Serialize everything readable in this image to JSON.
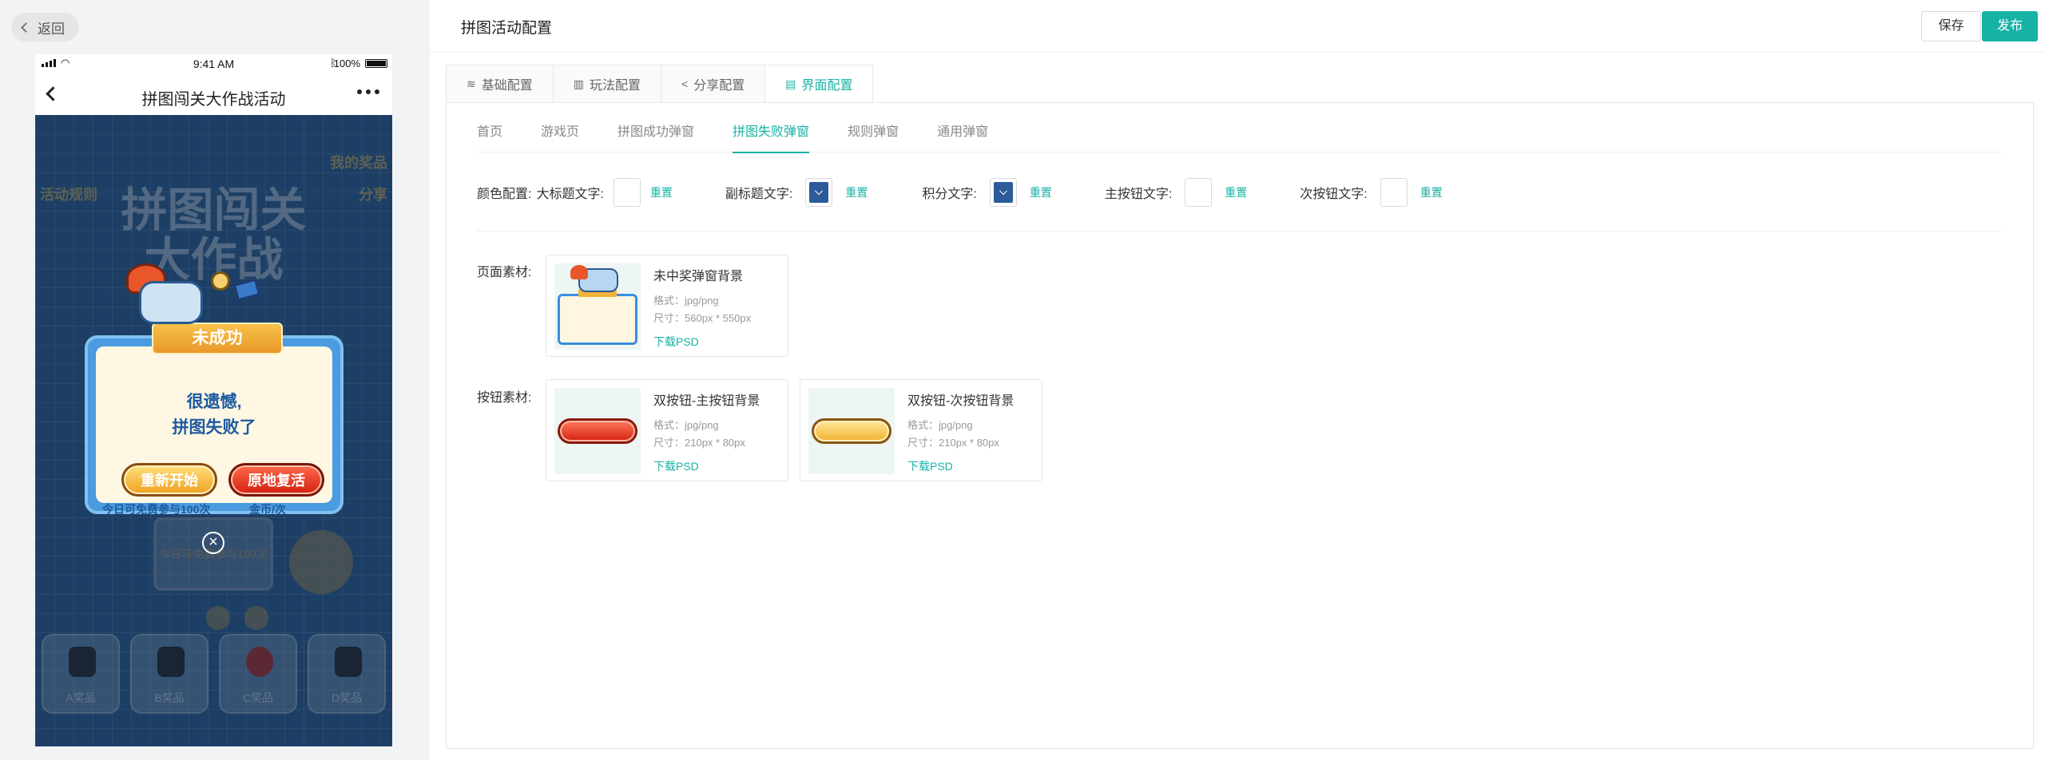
{
  "left": {
    "back_label": "返回",
    "phone": {
      "time": "9:41 AM",
      "battery": "100%",
      "nav_title": "拼图闯关大作战活动"
    },
    "game": {
      "title_line1": "拼图闯关",
      "title_line2": "大作战",
      "corner_left": "活动规则",
      "corner_right1": "我的奖品",
      "corner_right2": "分享",
      "board_text": "今日可免费参与100次",
      "popup": {
        "ribbon": "未成功",
        "message_line1": "很遗憾,",
        "message_line2": "拼图失败了",
        "btn_restart": "重新开始",
        "btn_revive": "原地复活",
        "note_left": "今日可免费参与100次",
        "note_right": "金币/次",
        "close_symbol": "×"
      },
      "prizes": [
        {
          "label": "A奖品"
        },
        {
          "label": "B奖品"
        },
        {
          "label": "C奖品"
        },
        {
          "label": "D奖品"
        }
      ]
    }
  },
  "header": {
    "title": "拼图活动配置",
    "save_label": "保存",
    "publish_label": "发布"
  },
  "tabs": [
    {
      "label": "基础配置",
      "icon": "layers-icon"
    },
    {
      "label": "玩法配置",
      "icon": "gift-icon"
    },
    {
      "label": "分享配置",
      "icon": "share-icon"
    },
    {
      "label": "界面配置",
      "icon": "layout-icon",
      "active": true
    }
  ],
  "subtabs": [
    {
      "label": "首页"
    },
    {
      "label": "游戏页"
    },
    {
      "label": "拼图成功弹窗"
    },
    {
      "label": "拼图失败弹窗",
      "active": true
    },
    {
      "label": "规则弹窗"
    },
    {
      "label": "通用弹窗"
    }
  ],
  "color_config": {
    "label": "颜色配置:",
    "reset_label": "重置",
    "items": [
      {
        "name": "大标题文字:",
        "color": "#ffffff"
      },
      {
        "name": "副标题文字:",
        "color": "#2d5b9a"
      },
      {
        "name": "积分文字:",
        "color": "#2d5b9a"
      },
      {
        "name": "主按钮文字:",
        "color": "#ffffff"
      },
      {
        "name": "次按钮文字:",
        "color": "#ffffff"
      }
    ]
  },
  "page_assets": {
    "label": "页面素材:",
    "items": [
      {
        "name": "未中奖弹窗背景",
        "format": "格式：jpg/png",
        "size": "尺寸：560px * 550px",
        "download": "下载PSD"
      }
    ]
  },
  "button_assets": {
    "label": "按钮素材:",
    "items": [
      {
        "name": "双按钮-主按钮背景",
        "format": "格式：jpg/png",
        "size": "尺寸：210px * 80px",
        "download": "下载PSD"
      },
      {
        "name": "双按钮-次按钮背景",
        "format": "格式：jpg/png",
        "size": "尺寸：210px * 80px",
        "download": "下载PSD"
      }
    ]
  },
  "colors": {
    "accent": "#17b2a6",
    "link": "#17b2a6"
  }
}
